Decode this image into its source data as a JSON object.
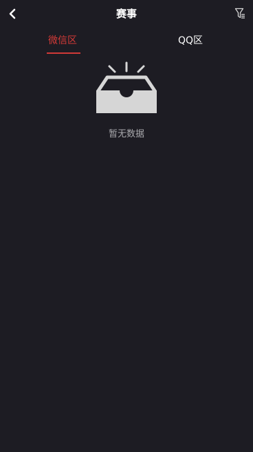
{
  "header": {
    "title": "赛事",
    "back_icon": "chevron-left-icon",
    "filter_icon": "filter-icon"
  },
  "tabs": [
    {
      "label": "微信区",
      "active": true
    },
    {
      "label": "QQ区",
      "active": false
    }
  ],
  "empty_state": {
    "icon": "empty-inbox-icon",
    "text": "暂无数据"
  },
  "colors": {
    "background": "#1d1c23",
    "accent": "#d23a37",
    "text_primary": "#ffffff",
    "text_muted": "#a9a9ad",
    "icon_gray": "#d6d6d6"
  }
}
